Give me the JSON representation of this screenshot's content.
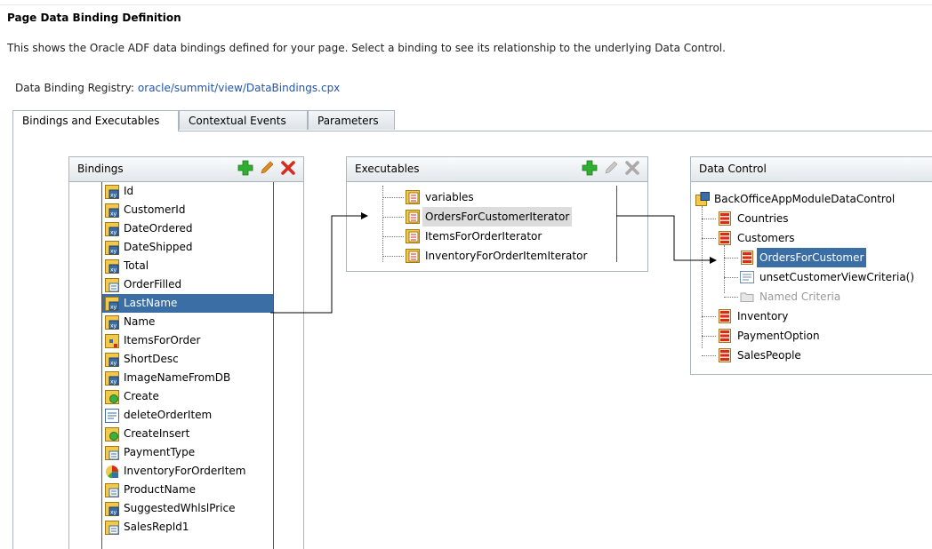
{
  "page": {
    "title": "Page Data Binding Definition",
    "description": "This shows the Oracle ADF data bindings defined for your page. Select a binding to see its relationship to the underlying Data Control.",
    "registry_label": "Data Binding Registry:",
    "registry_link": "oracle/summit/view/DataBindings.cpx"
  },
  "tabs": [
    {
      "label": "Bindings and Executables",
      "active": true
    },
    {
      "label": "Contextual Events",
      "active": false
    },
    {
      "label": "Parameters",
      "active": false
    }
  ],
  "bindings": {
    "title": "Bindings",
    "items": [
      {
        "label": "Id",
        "icon": "attribute-binding-icon"
      },
      {
        "label": "CustomerId",
        "icon": "attribute-binding-icon"
      },
      {
        "label": "DateOrdered",
        "icon": "attribute-binding-icon"
      },
      {
        "label": "DateShipped",
        "icon": "attribute-binding-icon"
      },
      {
        "label": "Total",
        "icon": "attribute-binding-icon"
      },
      {
        "label": "OrderFilled",
        "icon": "list-binding-icon"
      },
      {
        "label": "LastName",
        "icon": "attribute-binding-icon",
        "selected": true
      },
      {
        "label": "Name",
        "icon": "attribute-binding-icon"
      },
      {
        "label": "ItemsForOrder",
        "icon": "tree-binding-icon"
      },
      {
        "label": "ShortDesc",
        "icon": "attribute-binding-icon"
      },
      {
        "label": "ImageNameFromDB",
        "icon": "attribute-binding-icon"
      },
      {
        "label": "Create",
        "icon": "action-binding-icon"
      },
      {
        "label": "deleteOrderItem",
        "icon": "method-binding-icon"
      },
      {
        "label": "CreateInsert",
        "icon": "action-binding-icon"
      },
      {
        "label": "PaymentType",
        "icon": "list-binding-icon"
      },
      {
        "label": "InventoryForOrderItem",
        "icon": "graph-binding-icon"
      },
      {
        "label": "ProductName",
        "icon": "list-binding-icon"
      },
      {
        "label": "SuggestedWhlslPrice",
        "icon": "attribute-binding-icon"
      },
      {
        "label": "SalesRepId1",
        "icon": "list-binding-icon"
      }
    ]
  },
  "executables": {
    "title": "Executables",
    "items": [
      {
        "label": "variables",
        "icon": "iterator-icon"
      },
      {
        "label": "OrdersForCustomerIterator",
        "icon": "iterator-icon",
        "highlighted": true
      },
      {
        "label": "ItemsForOrderIterator",
        "icon": "iterator-icon"
      },
      {
        "label": "InventoryForOrderItemIterator",
        "icon": "iterator-icon"
      }
    ]
  },
  "data_control": {
    "title": "Data Control",
    "root": {
      "label": "BackOfficeAppModuleDataControl",
      "icon": "data-control-icon"
    },
    "items": [
      {
        "label": "Countries",
        "icon": "collection-icon",
        "level": 1
      },
      {
        "label": "Customers",
        "icon": "collection-icon",
        "level": 1
      },
      {
        "label": "OrdersForCustomer",
        "icon": "collection-icon",
        "level": 2,
        "selected": true
      },
      {
        "label": "unsetCustomerViewCriteria()",
        "icon": "method-icon",
        "level": 2
      },
      {
        "label": "Named Criteria",
        "icon": "folder-icon",
        "level": 2,
        "muted": true
      },
      {
        "label": "Inventory",
        "icon": "collection-icon",
        "level": 1
      },
      {
        "label": "PaymentOption",
        "icon": "collection-icon",
        "level": 1
      },
      {
        "label": "SalesPeople",
        "icon": "collection-icon",
        "level": 1
      }
    ]
  },
  "colors": {
    "selection": "#3a6ea5",
    "add": "#2fae2f",
    "delete": "#d62b1f",
    "edit": "#e08a1a"
  }
}
